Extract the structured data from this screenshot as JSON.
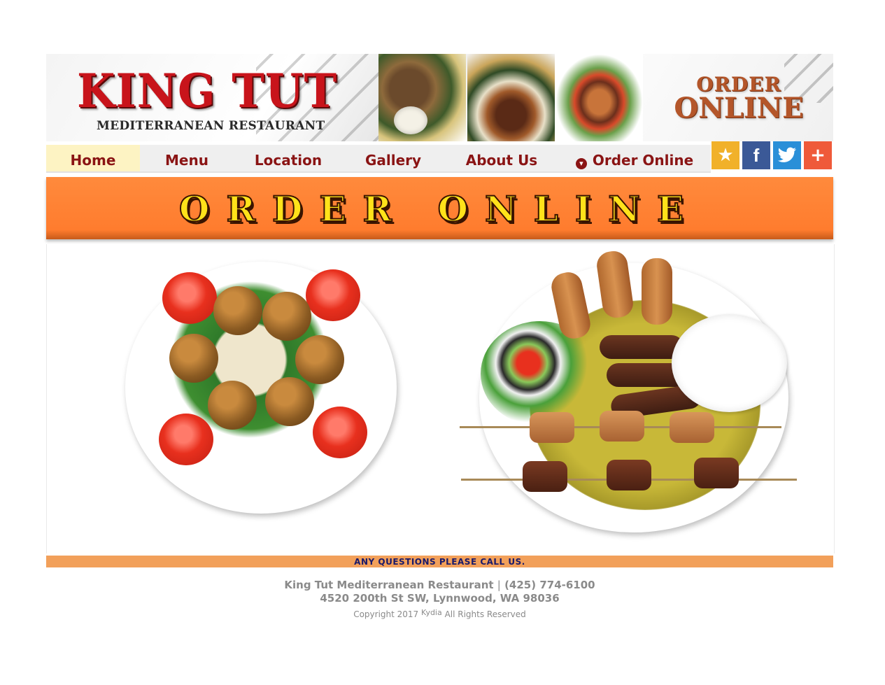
{
  "header": {
    "logo_title": "KING TUT",
    "logo_subtitle": "MEDITERRANEAN RESTAURANT",
    "order_logo_line1": "ORDER",
    "order_logo_line2": "ONLINE"
  },
  "nav": {
    "items": [
      {
        "label": "Home"
      },
      {
        "label": "Menu"
      },
      {
        "label": "Location"
      },
      {
        "label": "Gallery"
      },
      {
        "label": "About Us"
      },
      {
        "label": "Order Online"
      }
    ],
    "active": "Home"
  },
  "social": {
    "star": "★",
    "facebook": "f",
    "twitter": "🐦",
    "plus": "+"
  },
  "order_band": {
    "text": "ORDER ONLINE"
  },
  "call_bar": {
    "text": "ANY QUESTIONS PLEASE CALL US."
  },
  "footer": {
    "name": "King Tut Mediterranean Restaurant",
    "separator": "|",
    "phone": "(425) 774-6100",
    "address": "4520 200th St SW, Lynnwood, WA 98036",
    "copyright": "Copyright 2017",
    "brand": "Kydia",
    "rights": "All Rights Reserved"
  },
  "colors": {
    "nav_text": "#8a1414",
    "order_band": "#ff7c2e",
    "call_bar": "#f2a05a",
    "logo_red": "#c8141b"
  }
}
